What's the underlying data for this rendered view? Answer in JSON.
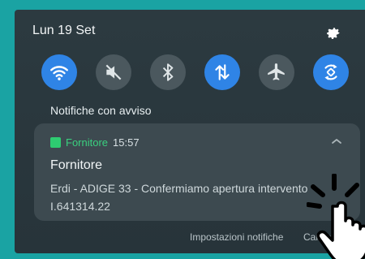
{
  "header": {
    "date": "Lun 19 Set"
  },
  "quick_settings": [
    {
      "icon": "wifi-icon",
      "state": "on"
    },
    {
      "icon": "mute-icon",
      "state": "off"
    },
    {
      "icon": "bluetooth-icon",
      "state": "off"
    },
    {
      "icon": "data-transfer-icon",
      "state": "on"
    },
    {
      "icon": "airplane-icon",
      "state": "off"
    },
    {
      "icon": "auto-rotate-icon",
      "state": "on"
    }
  ],
  "section": {
    "title": "Notifiche con avviso"
  },
  "notification": {
    "app_name": "Fornitore",
    "time": "15:57",
    "title": "Fornitore",
    "body": "Erdi - ADIGE 33 - Confermiamo apertura intervento I.641314.22"
  },
  "actions": {
    "settings_label": "Impostazioni notifiche",
    "clear_label": "Cancella"
  },
  "colors": {
    "accent_on": "#2f84e6",
    "tile_off": "#4b585e",
    "app_green": "#3ad07f",
    "frame_teal": "#1aa3a3"
  }
}
